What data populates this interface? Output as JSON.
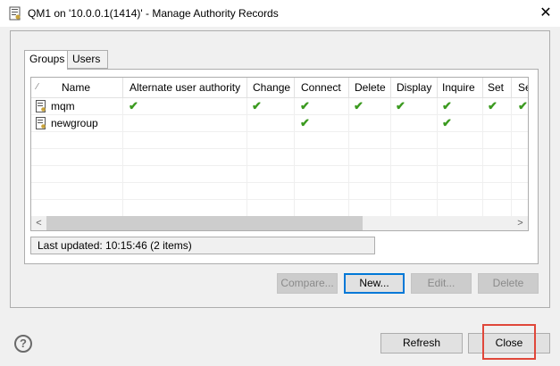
{
  "window": {
    "title": "QM1 on '10.0.0.1(1414)' - Manage Authority Records"
  },
  "tabs": [
    {
      "label": "Groups",
      "active": true
    },
    {
      "label": "Users",
      "active": false
    }
  ],
  "table": {
    "columns": [
      "Name",
      "Alternate user authority",
      "Change",
      "Connect",
      "Delete",
      "Display",
      "Inquire",
      "Set",
      "Se"
    ],
    "rows": [
      {
        "name": "mqm",
        "checks": [
          true,
          true,
          true,
          true,
          true,
          true,
          true,
          true
        ]
      },
      {
        "name": "newgroup",
        "checks": [
          false,
          false,
          true,
          false,
          false,
          true,
          false,
          false
        ]
      }
    ]
  },
  "status": {
    "text": "Last updated: 10:15:46 (2 items)"
  },
  "buttons": {
    "compare": "Compare...",
    "new": "New...",
    "edit": "Edit...",
    "delete": "Delete",
    "refresh": "Refresh",
    "close": "Close"
  },
  "help": {
    "glyph": "?"
  },
  "colors": {
    "check": "#3b9a1f",
    "highlight": "#e0473a",
    "focus": "#0078d7"
  }
}
